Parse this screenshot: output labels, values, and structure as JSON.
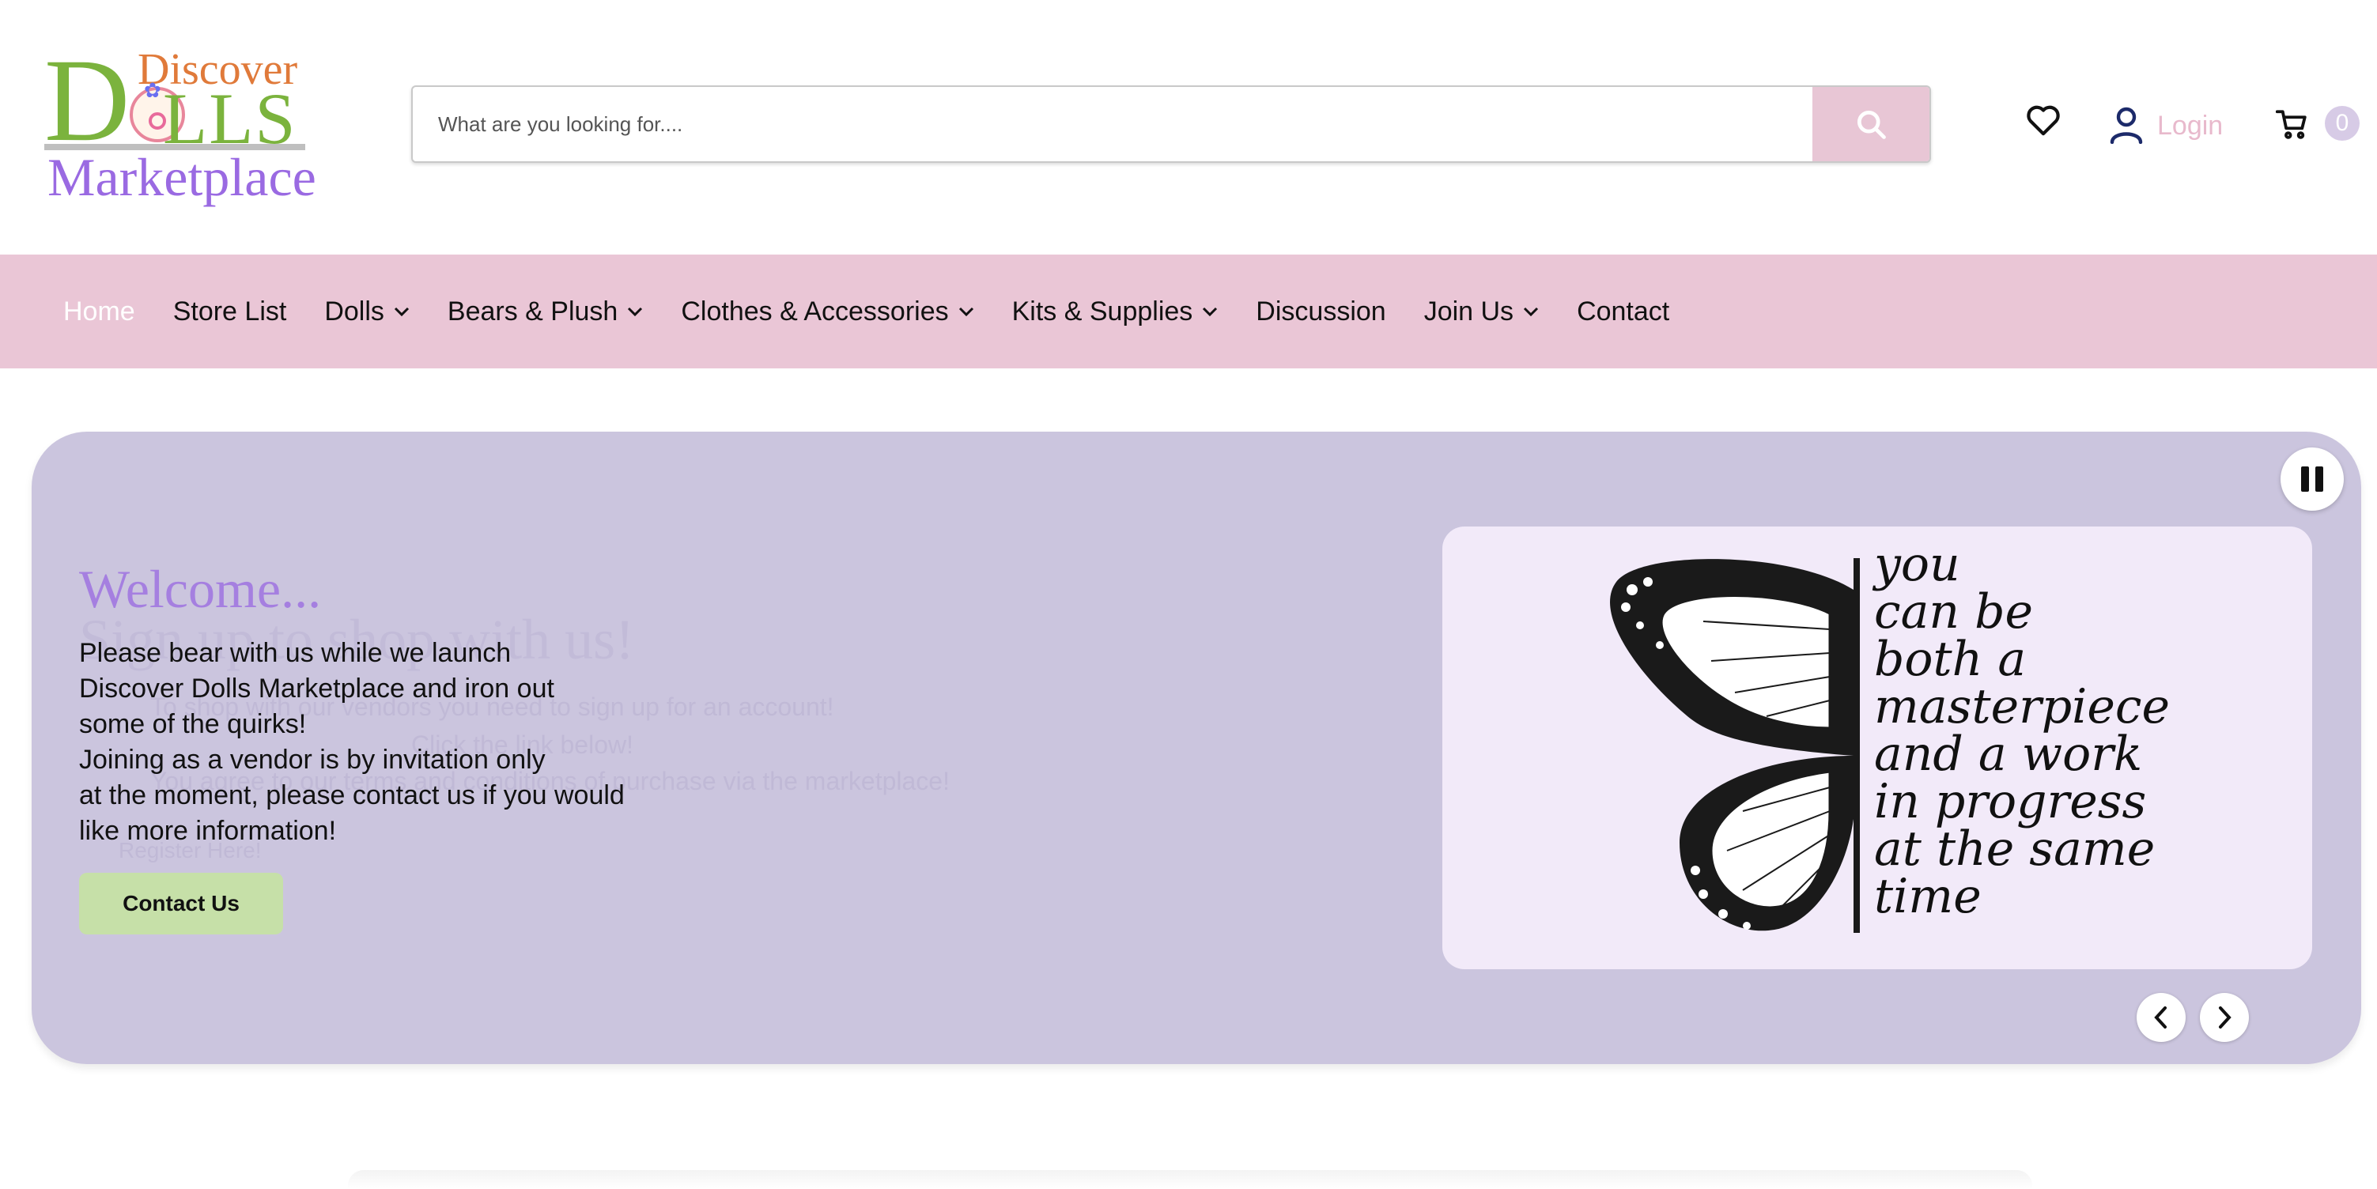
{
  "header": {
    "logo": {
      "line1": "Discover",
      "dolls_d": "D",
      "dolls_rest": "LLS",
      "line3": "Marketplace"
    },
    "search": {
      "placeholder": "What are you looking for....",
      "value": ""
    },
    "login_label": "Login",
    "cart_count": "0"
  },
  "nav": {
    "items": [
      {
        "label": "Home",
        "active": true,
        "dropdown": false
      },
      {
        "label": "Store List",
        "dropdown": false
      },
      {
        "label": "Dolls",
        "dropdown": true
      },
      {
        "label": "Bears & Plush",
        "dropdown": true
      },
      {
        "label": "Clothes & Accessories",
        "dropdown": true
      },
      {
        "label": "Kits & Supplies",
        "dropdown": true
      },
      {
        "label": "Discussion",
        "dropdown": false
      },
      {
        "label": "Join Us",
        "dropdown": true
      },
      {
        "label": "Contact",
        "dropdown": false
      }
    ]
  },
  "hero": {
    "ghost": {
      "title": "Sign up to shop with us!",
      "line1": "To shop with our vendors you need to sign up for an account!",
      "line2": "Click the link below!",
      "line3": "You agree to our terms and conditions of purchase via the marketplace!",
      "button": "Register Here!"
    },
    "title": "Welcome...",
    "lines": [
      "Please bear with us while we launch",
      "Discover Dolls Marketplace and iron out",
      "some of the quirks!",
      "Joining as a vendor is by invitation only",
      "at the moment, please contact us if you would",
      "like more information!"
    ],
    "button_label": "Contact Us",
    "quote_lines": [
      "you",
      "can be",
      "both a",
      "masterpiece",
      "and a work",
      "in progress",
      "at the same",
      "time"
    ]
  },
  "colors": {
    "nav_bg": "#eac6d6",
    "hero_bg": "#cbc5de",
    "accent_purple": "#a57fe0",
    "button_green": "#c6e0a8",
    "search_btn": "#e8c6d5"
  },
  "icons": [
    "search-icon",
    "heart-icon",
    "user-icon",
    "cart-icon",
    "chevron-down-icon",
    "pause-icon",
    "chevron-left-icon",
    "chevron-right-icon",
    "butterfly-icon"
  ]
}
